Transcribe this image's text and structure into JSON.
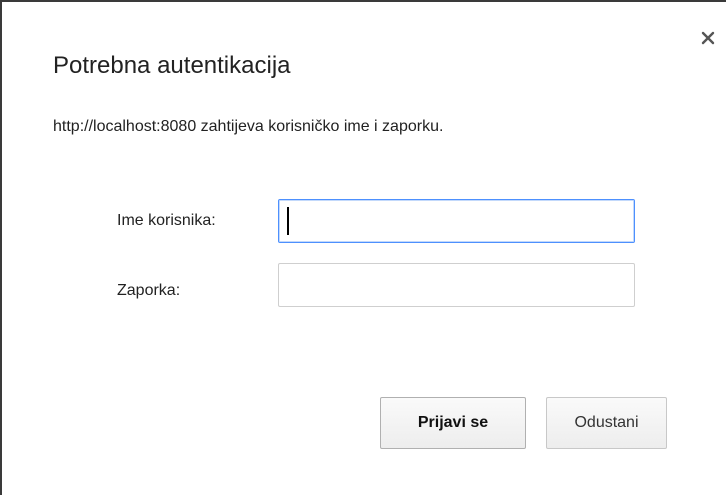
{
  "dialog": {
    "title": "Potrebna autentikacija",
    "message": "http://localhost:8080 zahtijeva korisničko ime i zaporku.",
    "close_icon": "close-icon"
  },
  "form": {
    "username_label": "Ime korisnika:",
    "username_value": "",
    "password_label": "Zaporka:",
    "password_value": ""
  },
  "buttons": {
    "login_label": "Prijavi se",
    "cancel_label": "Odustani"
  },
  "colors": {
    "focus_border": "#4d90fe",
    "text": "#222222"
  }
}
